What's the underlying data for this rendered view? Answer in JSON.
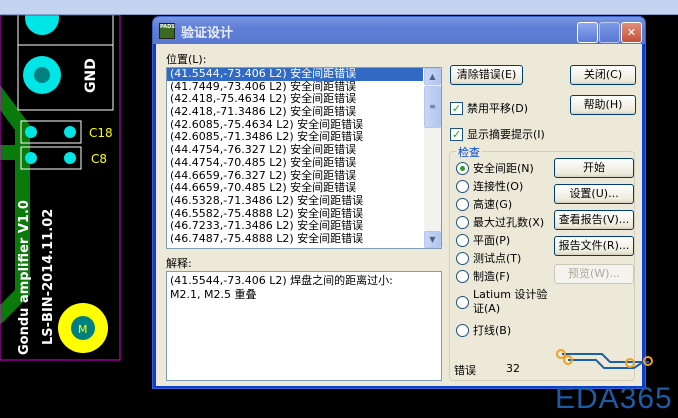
{
  "window": {
    "title": "验证设计",
    "logo_text": "PADS"
  },
  "location_label": "位置(L):",
  "locations": [
    "(41.5544,-73.406 L2) 安全间距错误",
    "(41.7449,-73.406 L2) 安全间距错误",
    "(42.418,-75.4634 L2) 安全间距错误",
    "(42.418,-71.3486 L2) 安全间距错误",
    "(42.6085,-75.4634 L2) 安全间距错误",
    "(42.6085,-71.3486 L2) 安全间距错误",
    "(44.4754,-76.327 L2) 安全间距错误",
    "(44.4754,-70.485 L2) 安全间距错误",
    "(44.6659,-76.327 L2) 安全间距错误",
    "(44.6659,-70.485 L2) 安全间距错误",
    "(46.5328,-71.3486 L2) 安全间距错误",
    "(46.5582,-75.4888 L2) 安全间距错误",
    "(46.7233,-71.3486 L2) 安全间距错误",
    "(46.7487,-75.4888 L2) 安全间距错误"
  ],
  "explanation_label": "解释:",
  "explanation": "(41.5544,-73.406 L2) 焊盘之间的距离过小: M2.1, M2.5 重叠",
  "buttons": {
    "clear": "清除错误(E)",
    "close": "关闭(C)",
    "help": "帮助(H)",
    "start": "开始",
    "setup": "设置(U)...",
    "view_report": "查看报告(V)...",
    "report_file": "报告文件(R)...",
    "preview": "预览(W)..."
  },
  "checkboxes": {
    "disable_pan": "禁用平移(D)",
    "show_summary": "显示摘要提示(I)"
  },
  "check_group": {
    "label": "检查",
    "options": [
      "安全间距(N)",
      "连接性(O)",
      "高速(G)",
      "最大过孔数(X)",
      "平面(P)",
      "测试点(T)",
      "制造(F)",
      "Latium 设计验证(A)",
      "打线(B)"
    ],
    "selected": 0
  },
  "errors": {
    "label": "错误",
    "count": "32"
  },
  "pcb": {
    "labels": [
      "GND",
      "C18",
      "C8",
      "LS-BIN-2014.11.02",
      "Gondu amplifier V1.0",
      "M"
    ]
  },
  "watermark": "EDA365"
}
